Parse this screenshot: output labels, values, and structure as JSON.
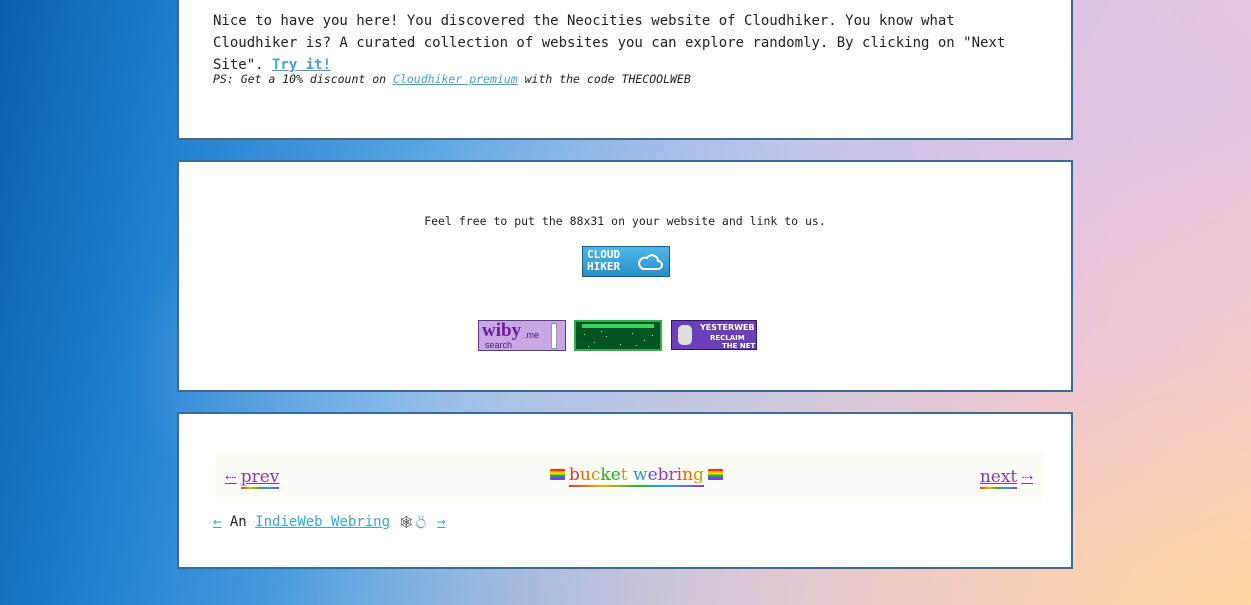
{
  "intro": {
    "text": "Nice to have you here! You discovered the Neocities website of Cloudhiker. You know what Cloudhiker is? A curated collection of websites you can explore randomly. By clicking on \"Next Site\".",
    "link": "Try it!"
  },
  "ps": {
    "prefix": "PS: Get a 10% discount on",
    "link": "Cloudhiker premium",
    "suffix": "with the code THECOOLWEB"
  },
  "share": {
    "text": "Feel free to put the 88x31 on your website and link to us.",
    "badge_line1": "CLOUD",
    "badge_line2": "HIKER"
  },
  "buttons": {
    "wiby_main": "wiby",
    "wiby_tld": ".me",
    "wiby_search": "search",
    "yesterweb_title": "YESTERWEB",
    "yesterweb_line2": "RECLAIM",
    "yesterweb_line3": "THE NET"
  },
  "webring": {
    "prev_arrow": "⇠",
    "prev_label": "prev",
    "title": "bucket webring",
    "next_label": "next",
    "next_arrow": "⇢"
  },
  "indieweb": {
    "left_arrow": "←",
    "prefix": "An",
    "link": "IndieWeb Webring",
    "emoji": "🕸💍",
    "right_arrow": "→"
  },
  "colors": {
    "link": "#3aa7cf",
    "panel_border": "#3a6c94",
    "webring_text": "#8a3aa8"
  }
}
